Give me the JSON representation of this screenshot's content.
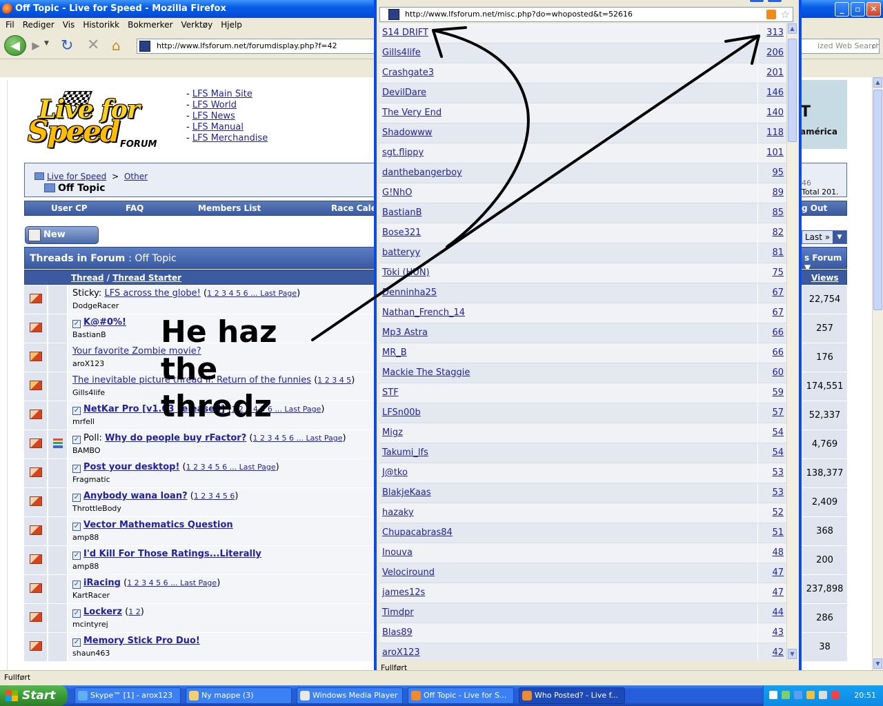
{
  "window": {
    "title": "Off Topic - Live for Speed - Mozilla Firefox"
  },
  "menu": [
    "Fil",
    "Rediger",
    "Vis",
    "Historikk",
    "Bokmerker",
    "Verktøy",
    "Hjelp"
  ],
  "nav": {
    "url": "http://www.lfsforum.net/forumdisplay.php?f=42",
    "search_placeholder": "ized Web Search"
  },
  "site": {
    "logo": {
      "line1": "Live for",
      "line2": "Speed",
      "line3": "FORUM"
    },
    "top_links": [
      "LFS Main Site",
      "LFS World",
      "LFS News",
      "LFS Manual",
      "LFS Merchandise"
    ],
    "banner_big": "T",
    "banner_small": "américa",
    "breadcrumb": {
      "root": "Live for Speed",
      "sep": ">",
      "parent": "Other",
      "current": "Off Topic"
    },
    "right_stats": {
      "line1": "46",
      "line2": "Total 201."
    },
    "menu": {
      "user_cp": "User CP",
      "faq": "FAQ",
      "members": "Members List",
      "race": "Race Calen",
      "logout": "g Out"
    },
    "new_thread": "New Thread",
    "last_page": "Last »",
    "threads_title": "Threads in Forum",
    "threads_forum": ": Off Topic",
    "forum_tools": "s Forum ▼",
    "col_thread": "Thread",
    "col_slash": "/",
    "col_starter": "Thread Starter",
    "col_views": "Views"
  },
  "threads": [
    {
      "prefix": "Sticky:",
      "title": "LFS across the globe!",
      "pages": "1 2 3 4 5 6 ... Last Page",
      "starter": "DodgeRacer",
      "views": "22,754",
      "bold": false,
      "check": false
    },
    {
      "prefix": "",
      "title": "K@#0%!",
      "pages": "",
      "starter": "BastianB",
      "views": "257",
      "bold": true,
      "check": true
    },
    {
      "prefix": "",
      "title": "Your favorite Zombie movie?",
      "pages": "",
      "starter": "aroX123",
      "views": "176",
      "bold": false,
      "check": false
    },
    {
      "prefix": "",
      "title": "The inevitable picture thread II: Return of the funnies",
      "pages": "1 2 3 4 5",
      "starter": "Gills4life",
      "views": "174,551",
      "bold": false,
      "check": false
    },
    {
      "prefix": "",
      "title": "NetKar Pro [v1.03 released]",
      "pages": "1 2 3 4 5 6 ... Last Page",
      "starter": "mrfell",
      "views": "52,337",
      "bold": true,
      "check": true
    },
    {
      "prefix": "Poll:",
      "title": "Why do people buy rFactor?",
      "pages": "1 2 3 4 5 6 ... Last Page",
      "starter": "BAMBO",
      "views": "4,769",
      "bold": true,
      "check": true,
      "poll": true
    },
    {
      "prefix": "",
      "title": "Post your desktop!",
      "pages": "1 2 3 4 5 6 ... Last Page",
      "starter": "Fragmatic",
      "views": "138,377",
      "bold": true,
      "check": true
    },
    {
      "prefix": "",
      "title": "Anybody wana loan?",
      "pages": "1 2 3 4 5 6",
      "starter": "ThrottleBody",
      "views": "2,409",
      "bold": true,
      "check": true
    },
    {
      "prefix": "",
      "title": "Vector Mathematics Question",
      "pages": "",
      "starter": "amp88",
      "views": "368",
      "bold": true,
      "check": true
    },
    {
      "prefix": "",
      "title": "I'd Kill For Those Ratings...Literally",
      "pages": "",
      "starter": "amp88",
      "views": "200",
      "bold": true,
      "check": true
    },
    {
      "prefix": "",
      "title": "iRacing",
      "pages": "1 2 3 4 5 6 ... Last Page",
      "starter": "KartRacer",
      "views": "237,898",
      "bold": true,
      "check": true
    },
    {
      "prefix": "",
      "title": "Lockerz",
      "pages": "1 2",
      "starter": "mcintyrej",
      "views": "286",
      "bold": true,
      "check": true
    },
    {
      "prefix": "",
      "title": "Memory Stick Pro Duo!",
      "pages": "",
      "starter": "shaun463",
      "views": "38",
      "bold": true,
      "check": true
    }
  ],
  "annotation": [
    "He haz",
    "the",
    "thredz"
  ],
  "popup": {
    "url": "http://www.lfsforum.net/misc.php?do=whoposted&t=52616",
    "status": "Fullført",
    "posters": [
      {
        "name": "S14 DRIFT",
        "count": "313"
      },
      {
        "name": "Gills4life",
        "count": "206"
      },
      {
        "name": "Crashgate3",
        "count": "201"
      },
      {
        "name": "DevilDare",
        "count": "146"
      },
      {
        "name": "The Very End",
        "count": "140"
      },
      {
        "name": "Shadowww",
        "count": "118"
      },
      {
        "name": "sgt.flippy",
        "count": "101"
      },
      {
        "name": "danthebangerboy",
        "count": "95"
      },
      {
        "name": "G!NhO",
        "count": "89"
      },
      {
        "name": "BastianB",
        "count": "85"
      },
      {
        "name": "Bose321",
        "count": "82"
      },
      {
        "name": "batteryy",
        "count": "81"
      },
      {
        "name": "Töki (HUN)",
        "count": "75"
      },
      {
        "name": "Denninha25",
        "count": "67"
      },
      {
        "name": "Nathan_French_14",
        "count": "67"
      },
      {
        "name": "Mp3 Astra",
        "count": "66"
      },
      {
        "name": "MR_B",
        "count": "66"
      },
      {
        "name": "Mackie The Staggie",
        "count": "60"
      },
      {
        "name": "STF",
        "count": "59"
      },
      {
        "name": "LFSn00b",
        "count": "57"
      },
      {
        "name": "Migz",
        "count": "54"
      },
      {
        "name": "Takumi_lfs",
        "count": "54"
      },
      {
        "name": "J@tko",
        "count": "53"
      },
      {
        "name": "BlakjeKaas",
        "count": "53"
      },
      {
        "name": "hazaky",
        "count": "52"
      },
      {
        "name": "Chupacabras84",
        "count": "51"
      },
      {
        "name": "Inouva",
        "count": "48"
      },
      {
        "name": "Velociround",
        "count": "47"
      },
      {
        "name": "james12s",
        "count": "47"
      },
      {
        "name": "Timdpr",
        "count": "44"
      },
      {
        "name": "Blas89",
        "count": "43"
      },
      {
        "name": "aroX123",
        "count": "42"
      }
    ]
  },
  "statusbar": "Fullført",
  "taskbar": {
    "start": "Start",
    "tasks": [
      "Skype™ [1] - arox123",
      "Ny mappe (3)",
      "Windows Media Player",
      "Off Topic - Live for S...",
      "Who Posted? - Live f..."
    ],
    "clock": "20:51"
  }
}
